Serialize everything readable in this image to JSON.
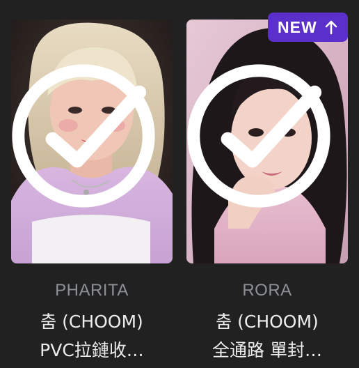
{
  "cards": [
    {
      "artist": "PHARITA",
      "title_line1": "춤 (CHOOM)",
      "title_line2": "PVC拉鏈收…",
      "checked": true
    },
    {
      "badge": "NEW",
      "artist": "RORA",
      "title_line1": "춤 (CHOOM)",
      "title_line2": "全通路 單封…",
      "checked": true
    }
  ],
  "colors": {
    "background": "#212121",
    "badge": "#5b2fc9",
    "artist_text": "#8d9196",
    "title_text": "#ececec"
  },
  "icons": {
    "check": "check-circle-icon",
    "badge_arrow": "arrow-up-icon"
  }
}
